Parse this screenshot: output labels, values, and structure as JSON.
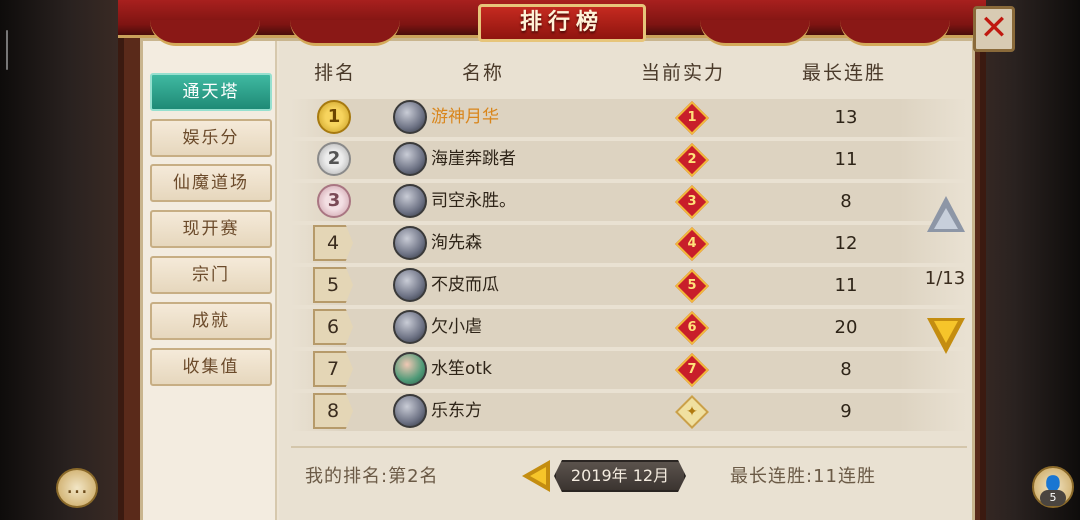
{
  "title": "排行榜",
  "close_symbol": "✕",
  "sidebar": {
    "items": [
      {
        "label": "通天塔",
        "active": true
      },
      {
        "label": "娱乐分",
        "active": false
      },
      {
        "label": "仙魔道场",
        "active": false
      },
      {
        "label": "现开赛",
        "active": false
      },
      {
        "label": "宗门",
        "active": false
      },
      {
        "label": "成就",
        "active": false
      },
      {
        "label": "收集值",
        "active": false
      }
    ]
  },
  "table": {
    "headers": {
      "rank": "排名",
      "name": "名称",
      "power": "当前实力",
      "streak": "最长连胜"
    },
    "rows": [
      {
        "rank": "1",
        "name": "游神月华",
        "power": "1",
        "streak": "13"
      },
      {
        "rank": "2",
        "name": "海崖奔跳者",
        "power": "2",
        "streak": "11"
      },
      {
        "rank": "3",
        "name": "司空永胜。",
        "power": "3",
        "streak": "8"
      },
      {
        "rank": "4",
        "name": "洵先森",
        "power": "4",
        "streak": "12"
      },
      {
        "rank": "5",
        "name": "不皮而瓜",
        "power": "5",
        "streak": "11"
      },
      {
        "rank": "6",
        "name": "欠小虐",
        "power": "6",
        "streak": "20"
      },
      {
        "rank": "7",
        "name": "水笙otk",
        "power": "7",
        "streak": "8"
      },
      {
        "rank": "8",
        "name": "乐东方",
        "power": "✦",
        "streak": "9"
      }
    ]
  },
  "pager": {
    "label": "1/13"
  },
  "footer": {
    "my_rank": "我的排名:第2名",
    "date": "2019年  12月",
    "my_streak": "最长连胜:11连胜"
  },
  "chat": {
    "icon": "chat-icon",
    "glyph": "…"
  },
  "friends": {
    "icon": "friends-icon",
    "glyph": "👤",
    "count": "5"
  },
  "colors": {
    "accent_active": "#1f8a76",
    "gold_name": "#d9861c",
    "curtain": "#a8201e"
  }
}
